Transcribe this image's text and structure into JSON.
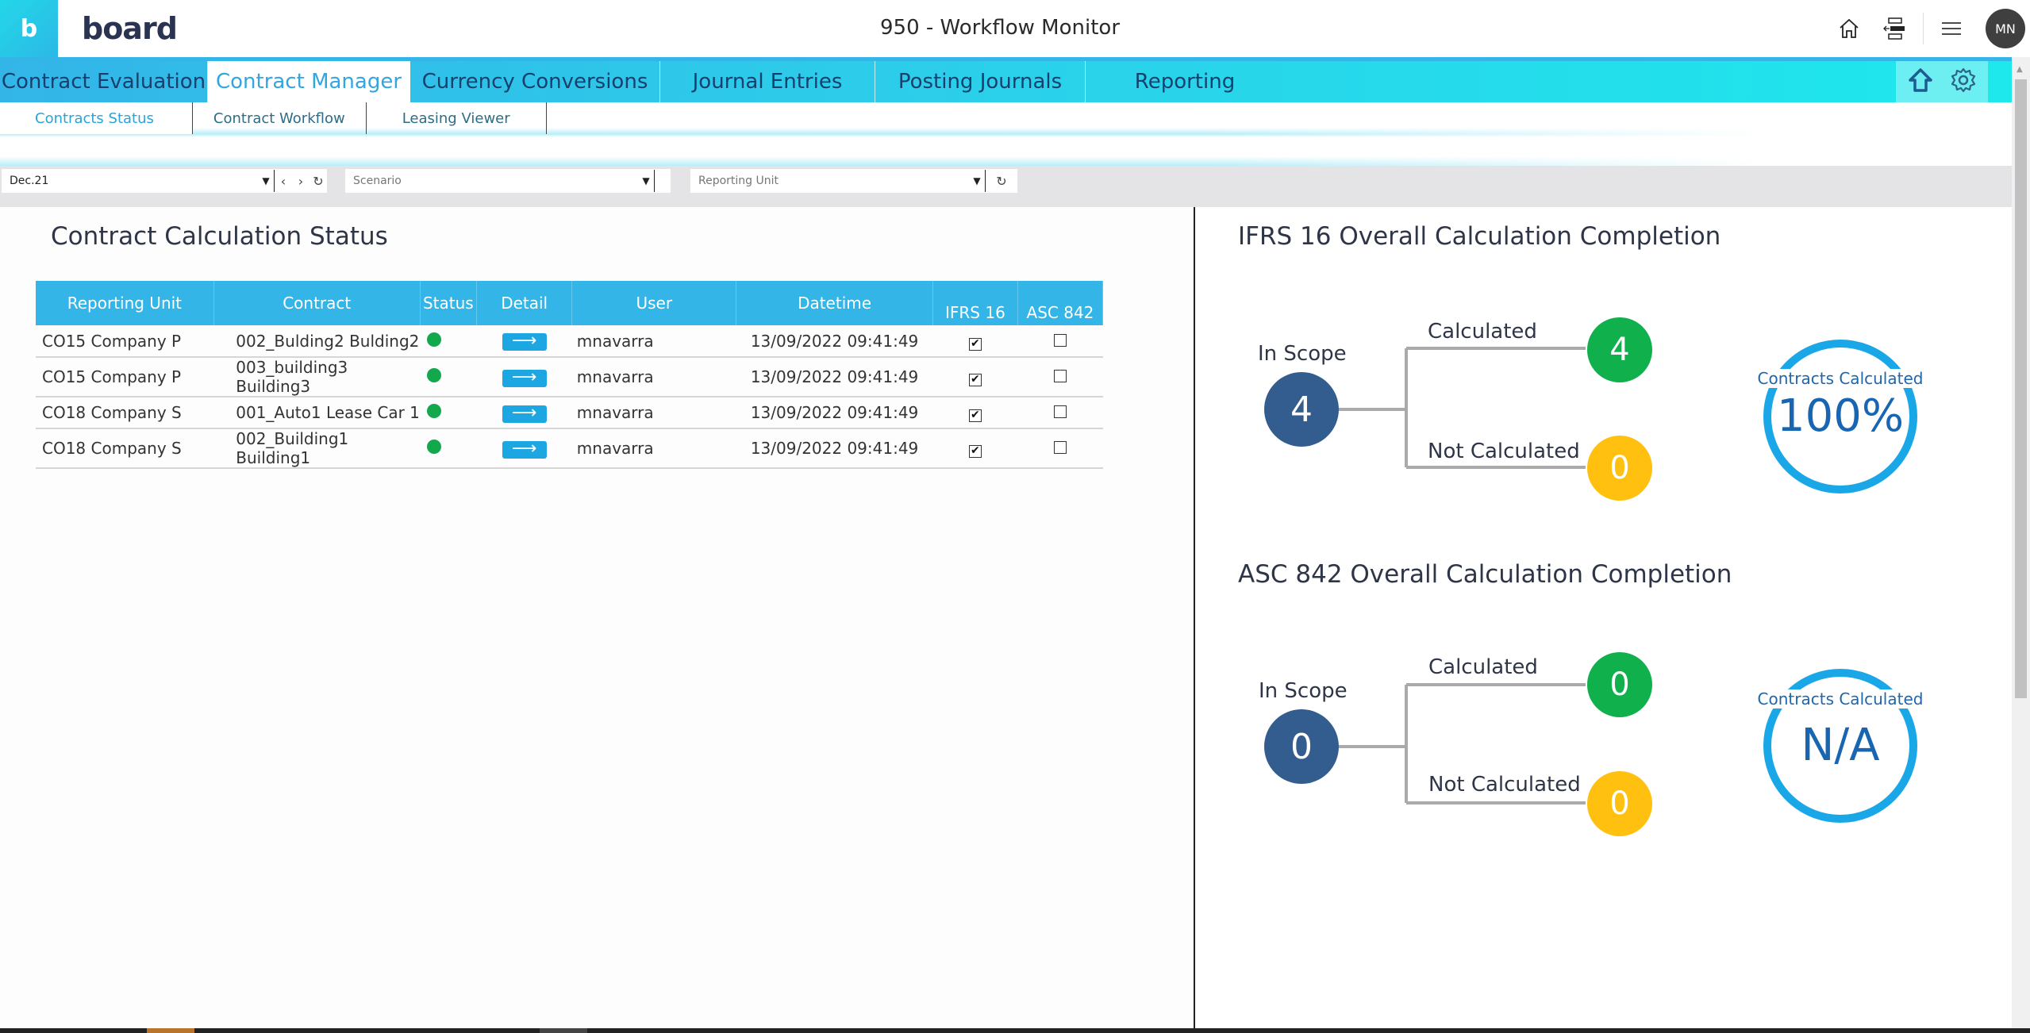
{
  "header": {
    "logo_letter": "b",
    "brand": "board",
    "title": "950 - Workflow Monitor",
    "user_initials": "MN",
    "icons": [
      "home-icon",
      "panel-collapse-icon",
      "hamburger-menu-icon"
    ]
  },
  "tabs": [
    {
      "label": "Contract Evaluation",
      "active": false
    },
    {
      "label": "Contract Manager",
      "active": true
    },
    {
      "label": "Currency Conversions",
      "active": false
    },
    {
      "label": "Journal Entries",
      "active": false
    },
    {
      "label": "Posting Journals",
      "active": false
    },
    {
      "label": "Reporting",
      "active": false
    }
  ],
  "tab_icons": [
    "home-outline-icon",
    "gear-icon"
  ],
  "subtabs": [
    {
      "label": "Contracts Status",
      "active": true
    },
    {
      "label": "Contract Workflow",
      "active": false
    },
    {
      "label": "Leasing Viewer",
      "active": false
    }
  ],
  "filters": {
    "period": {
      "value": "Dec.21"
    },
    "scenario": {
      "placeholder": "Scenario"
    },
    "reporting_unit": {
      "placeholder": "Reporting Unit"
    }
  },
  "left": {
    "title": "Contract Calculation Status",
    "columns": [
      "Reporting Unit",
      "Contract",
      "Status",
      "Detail",
      "User",
      "Datetime",
      "IFRS 16",
      "ASC 842"
    ],
    "rows": [
      {
        "reporting_unit": "CO15 Company P",
        "contract": "002_Bulding2 Bulding2",
        "status": "green",
        "user": "mnavarra",
        "datetime": "13/09/2022 09:41:49",
        "ifrs16": true,
        "asc842": false
      },
      {
        "reporting_unit": "CO15 Company P",
        "contract": "003_building3 Building3",
        "status": "green",
        "user": "mnavarra",
        "datetime": "13/09/2022 09:41:49",
        "ifrs16": true,
        "asc842": false
      },
      {
        "reporting_unit": "CO18 Company S",
        "contract": "001_Auto1 Lease Car 1",
        "status": "green",
        "user": "mnavarra",
        "datetime": "13/09/2022 09:41:49",
        "ifrs16": true,
        "asc842": false
      },
      {
        "reporting_unit": "CO18 Company S",
        "contract": "002_Building1 Building1",
        "status": "green",
        "user": "mnavarra",
        "datetime": "13/09/2022 09:41:49",
        "ifrs16": true,
        "asc842": false
      }
    ]
  },
  "ifrs16": {
    "title": "IFRS 16 Overall Calculation Completion",
    "in_scope_label": "In Scope",
    "in_scope": "4",
    "calculated_label": "Calculated",
    "calculated": "4",
    "not_calculated_label": "Not Calculated",
    "not_calculated": "0",
    "ring_caption": "Contracts Calculated",
    "ring_value": "100%"
  },
  "asc842": {
    "title": "ASC 842 Overall Calculation Completion",
    "in_scope_label": "In Scope",
    "in_scope": "0",
    "calculated_label": "Calculated",
    "calculated": "0",
    "not_calculated_label": "Not Calculated",
    "not_calculated": "0",
    "ring_caption": "Contracts Calculated",
    "ring_value": "N/A"
  },
  "colors": {
    "accent": "#33b5e8",
    "tab_text": "#17406e",
    "node_blue": "#335c8f",
    "node_green": "#10b04c",
    "node_yellow": "#ffc010",
    "ring": "#1aa7e8"
  }
}
